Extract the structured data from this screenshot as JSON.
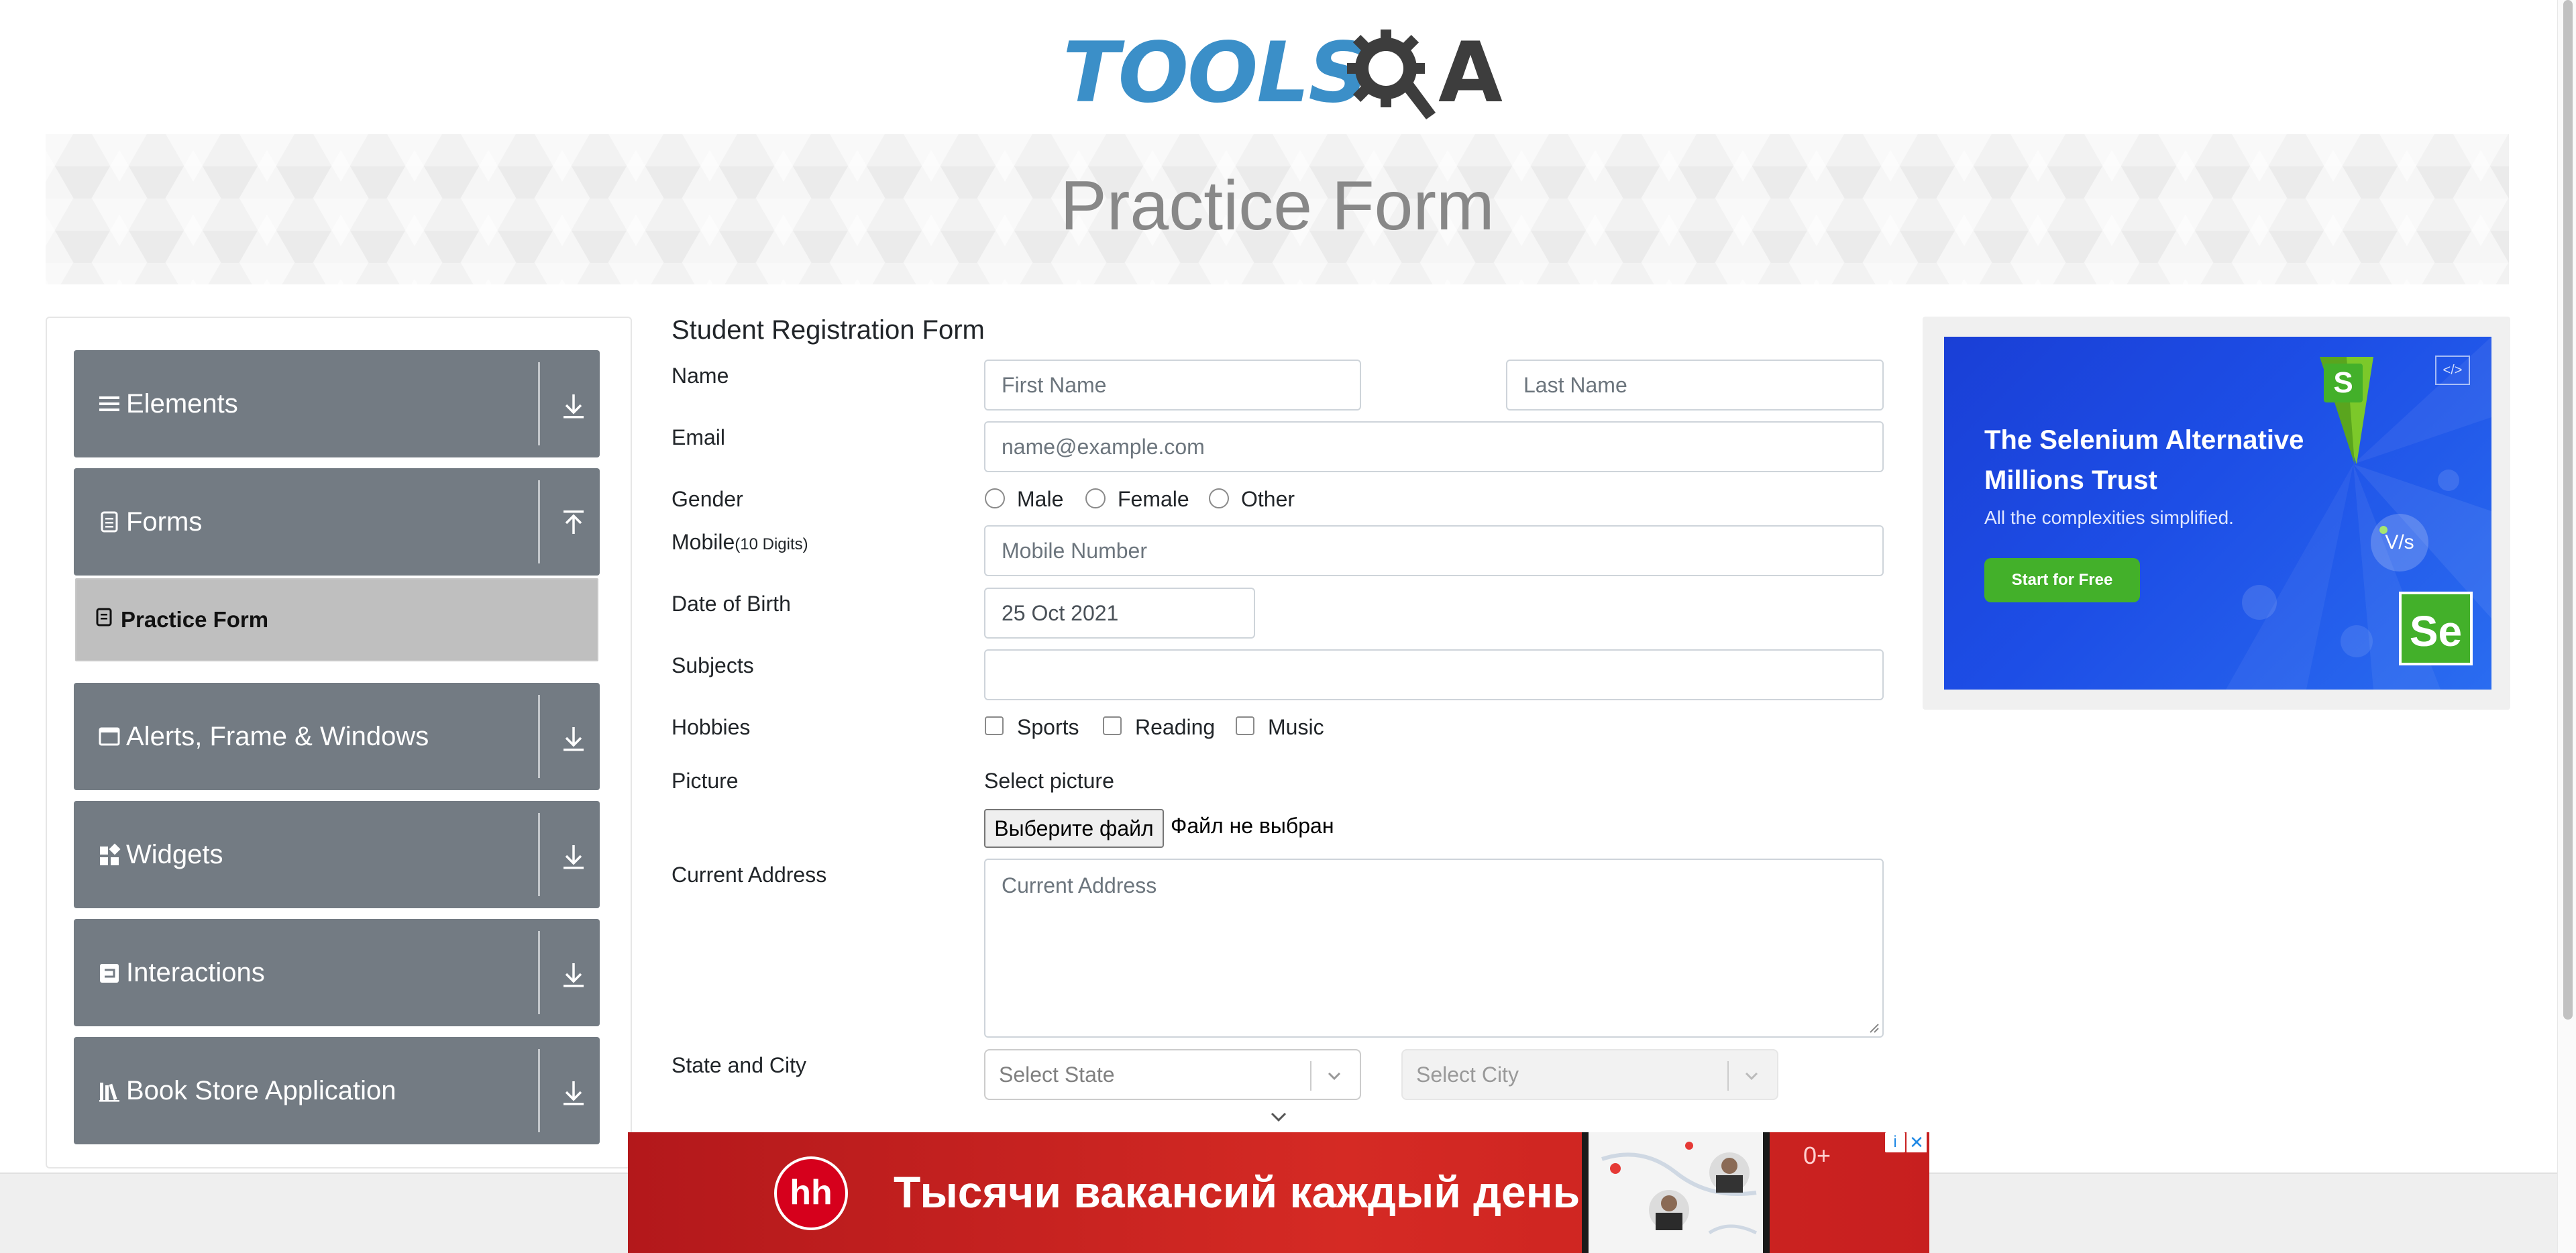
{
  "logo": {
    "text_tools": "TOOLS",
    "text_a": "A",
    "alt": "ToolsQA"
  },
  "banner": {
    "title": "Practice Form"
  },
  "sidebar": {
    "groups": [
      {
        "label": "Elements",
        "icon": "list-icon",
        "arrow": "download-arrow-icon"
      },
      {
        "label": "Forms",
        "icon": "document-icon",
        "arrow": "upload-arrow-icon"
      },
      {
        "label": "Alerts, Frame & Windows",
        "icon": "window-icon",
        "arrow": "download-arrow-icon"
      },
      {
        "label": "Widgets",
        "icon": "widgets-icon",
        "arrow": "download-arrow-icon"
      },
      {
        "label": "Interactions",
        "icon": "interactions-icon",
        "arrow": "download-arrow-icon"
      },
      {
        "label": "Book Store Application",
        "icon": "books-icon",
        "arrow": "download-arrow-icon"
      }
    ],
    "active_subitem": {
      "label": "Practice Form",
      "icon": "form-icon"
    }
  },
  "form": {
    "title": "Student Registration Form",
    "name_label": "Name",
    "first_name_placeholder": "First Name",
    "last_name_placeholder": "Last Name",
    "email_label": "Email",
    "email_placeholder": "name@example.com",
    "gender_label": "Gender",
    "gender_options": [
      "Male",
      "Female",
      "Other"
    ],
    "mobile_label": "Mobile",
    "mobile_hint": "(10 Digits)",
    "mobile_placeholder": "Mobile Number",
    "dob_label": "Date of Birth",
    "dob_value": "25 Oct 2021",
    "subjects_label": "Subjects",
    "hobbies_label": "Hobbies",
    "hobbies_options": [
      "Sports",
      "Reading",
      "Music"
    ],
    "picture_label": "Picture",
    "select_picture": "Select picture",
    "file_button": "Выберите файл",
    "file_status": "Файл не выбран",
    "address_label": "Current Address",
    "address_placeholder": "Current Address",
    "state_city_label": "State and City",
    "state_placeholder": "Select State",
    "city_placeholder": "Select City"
  },
  "right_ad": {
    "title": "The Selenium Alternative Millions Trust",
    "subtitle": "All the complexities simplified.",
    "button": "Start for Free",
    "badge_s": "S",
    "badge_se": "Se",
    "badge_vs": "V/s",
    "code_icon": "</>"
  },
  "bottom_ad": {
    "logo": "hh",
    "text": "Тысячи вакансий каждый день",
    "age": "0+",
    "adchoices": "i",
    "close": "✕"
  },
  "colors": {
    "accent_blue": "#3b8fc8",
    "sidebar_gray": "#737b83",
    "active_item": "#bfbfbf",
    "ad_blue": "#1d4ee6",
    "ad_green": "#43b02a",
    "bottom_ad_red": "#d52a24"
  }
}
